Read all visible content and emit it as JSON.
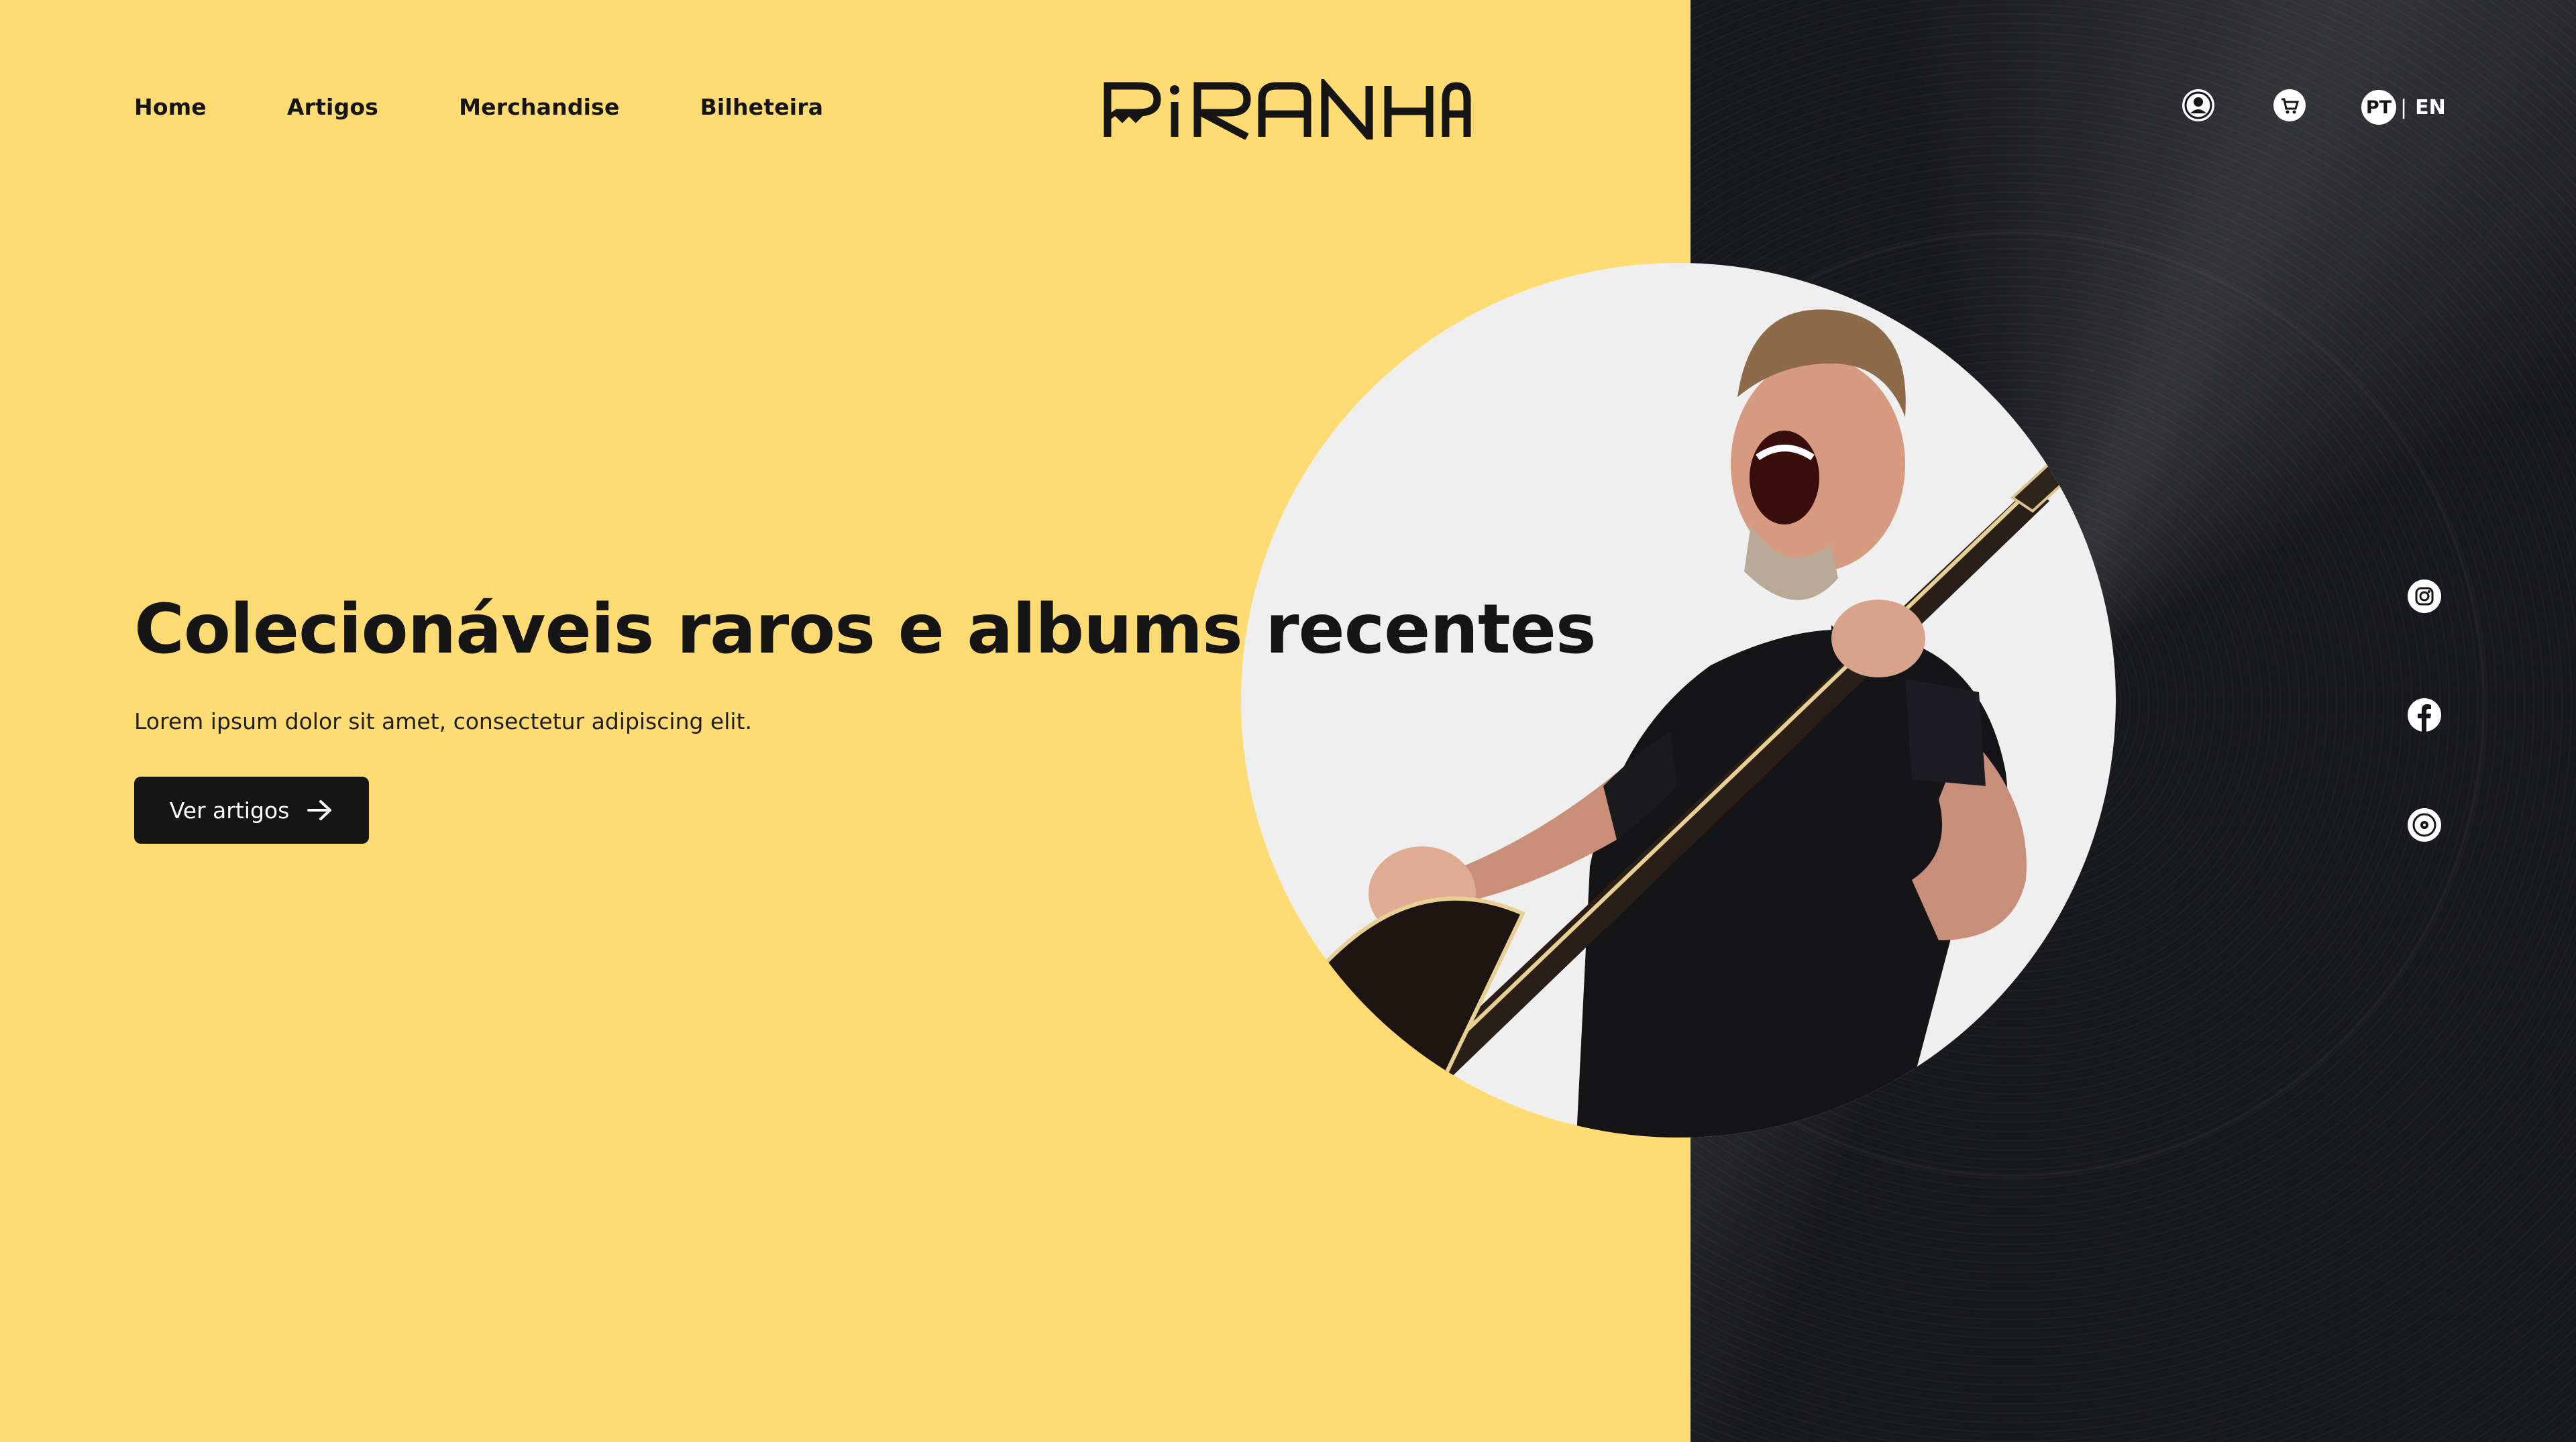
{
  "nav": {
    "items": [
      {
        "label": "Home"
      },
      {
        "label": "Artigos"
      },
      {
        "label": "Merchandise"
      },
      {
        "label": "Bilheteira"
      }
    ]
  },
  "brand": {
    "logo_text": "PiRANHA",
    "accent": "#ffdc73",
    "dark": "#141519"
  },
  "header": {
    "icons": [
      "user-icon",
      "cart-icon"
    ],
    "language": {
      "active": "PT",
      "separator": "|",
      "other": "EN"
    }
  },
  "hero": {
    "title": "Colecionáveis raros e albums recentes",
    "subtitle": "Lorem ipsum dolor sit amet, consectetur adipiscing elit.",
    "cta_label": "Ver artigos",
    "cta_icon": "arrow-right-icon"
  },
  "social": [
    "instagram-icon",
    "facebook-icon",
    "music-disc-icon"
  ]
}
